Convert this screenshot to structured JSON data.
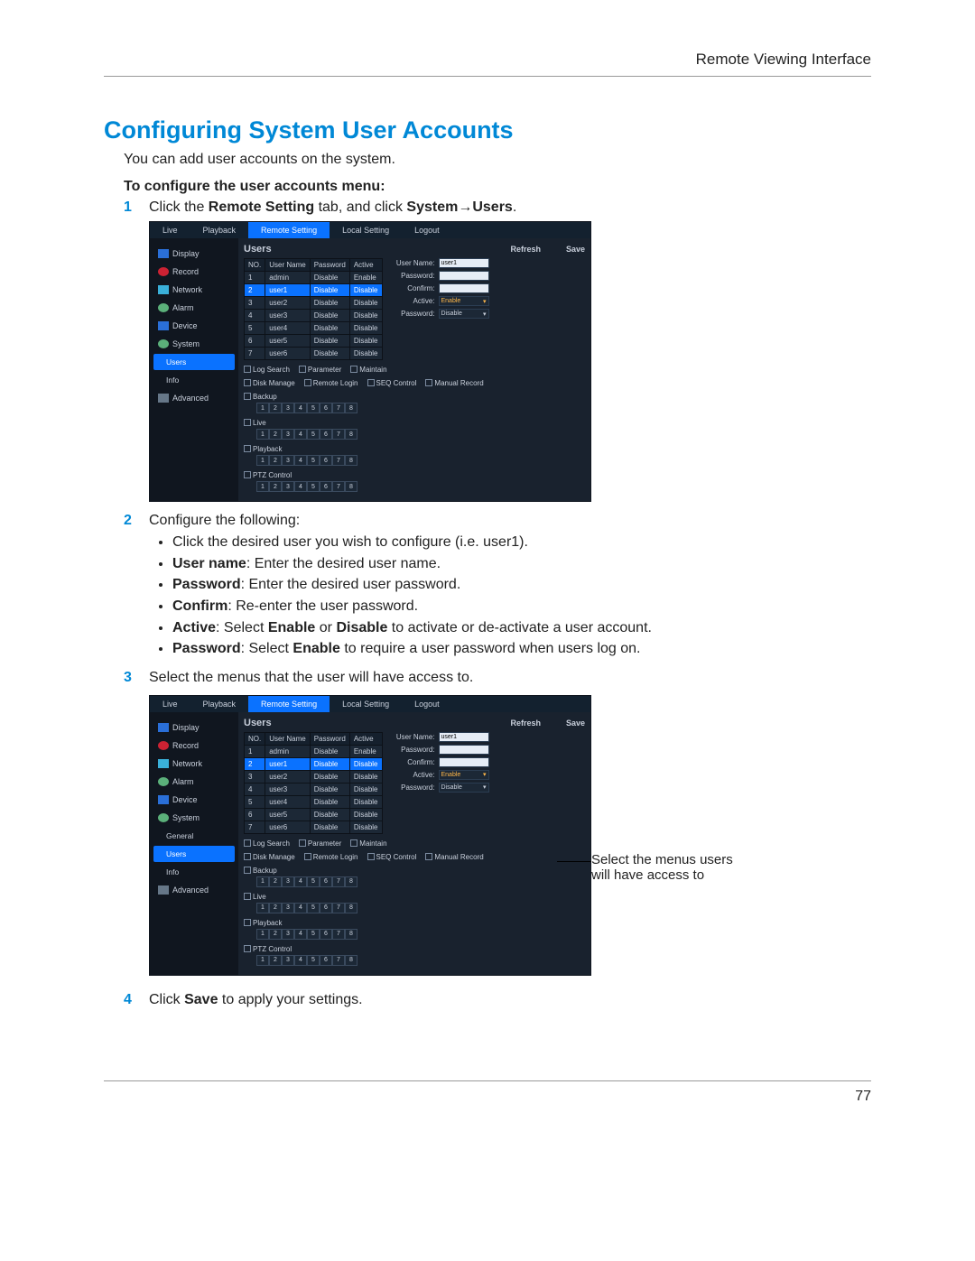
{
  "header": {
    "region": "Remote Viewing Interface"
  },
  "title": "Configuring System User Accounts",
  "intro": "You can add user accounts on the system.",
  "subheader": "To configure the user accounts menu:",
  "step1": {
    "num": "1",
    "prefix": "Click the ",
    "b1": "Remote Setting",
    "mid": " tab, and click ",
    "b2": "System→Users",
    "suffix": "."
  },
  "step2": {
    "num": "2",
    "text": "Configure the following:"
  },
  "bullets": [
    {
      "text": "Click the desired user you wish to configure (i.e. user1)."
    },
    {
      "b": "User name",
      "rest": ": Enter the desired user name."
    },
    {
      "b": "Password",
      "rest": ": Enter the desired user password."
    },
    {
      "b": "Confirm",
      "rest": ": Re-enter the user password."
    },
    {
      "b": "Active",
      "rest_a": ": Select ",
      "b2": "Enable",
      "rest_b": " or ",
      "b3": "Disable",
      "rest_c": " to activate or de-activate a user account."
    },
    {
      "b": "Password",
      "rest_a": ": Select ",
      "b2": "Enable",
      "rest_b": " to require a user password when users log on."
    }
  ],
  "step3": {
    "num": "3",
    "text": "Select the menus that the user will have access to."
  },
  "step4": {
    "num": "4",
    "prefix": "Click ",
    "b": "Save",
    "suffix": " to apply your settings."
  },
  "callout": {
    "text1": "Select the menus users",
    "text2": "will have access to"
  },
  "page_num": "77",
  "screenshot": {
    "tabs": [
      "Live",
      "Playback",
      "Remote Setting",
      "Local Setting",
      "Logout"
    ],
    "active_tab": 2,
    "sidebar": {
      "items": [
        {
          "icon": "blue",
          "label": "Display"
        },
        {
          "icon": "red",
          "label": "Record"
        },
        {
          "icon": "cyan",
          "label": "Network"
        },
        {
          "icon": "gear",
          "label": "Alarm"
        },
        {
          "icon": "blue",
          "label": "Device"
        },
        {
          "icon": "gear",
          "label": "System"
        }
      ],
      "subitems": [
        {
          "label": "General"
        },
        {
          "label": "Users",
          "selected": true
        },
        {
          "label": "Info"
        }
      ],
      "advanced": {
        "icon": "grey",
        "label": "Advanced"
      }
    },
    "main": {
      "title": "Users",
      "refresh": "Refresh",
      "save": "Save",
      "table_headers": [
        "NO.",
        "User Name",
        "Password",
        "Active"
      ],
      "rows": [
        [
          "1",
          "admin",
          "Disable",
          "Enable"
        ],
        [
          "2",
          "user1",
          "Disable",
          "Disable"
        ],
        [
          "3",
          "user2",
          "Disable",
          "Disable"
        ],
        [
          "4",
          "user3",
          "Disable",
          "Disable"
        ],
        [
          "5",
          "user4",
          "Disable",
          "Disable"
        ],
        [
          "6",
          "user5",
          "Disable",
          "Disable"
        ],
        [
          "7",
          "user6",
          "Disable",
          "Disable"
        ]
      ],
      "selected_row": 1,
      "form": {
        "user_name_label": "User Name:",
        "user_name_value": "user1",
        "password_label": "Password:",
        "confirm_label": "Confirm:",
        "active_label": "Active:",
        "active_value": "Enable",
        "pwdreq_label": "Password:",
        "pwdreq_value": "Disable",
        "arrow": "▾"
      },
      "perm1": [
        "Log Search",
        "Parameter",
        "Maintain"
      ],
      "perm2": [
        "Disk Manage",
        "Remote Login",
        "SEQ Control",
        "Manual Record"
      ],
      "channel_groups": [
        "Backup",
        "Live",
        "Playback",
        "PTZ Control"
      ],
      "channels": [
        "1",
        "2",
        "3",
        "4",
        "5",
        "6",
        "7",
        "8"
      ]
    }
  }
}
